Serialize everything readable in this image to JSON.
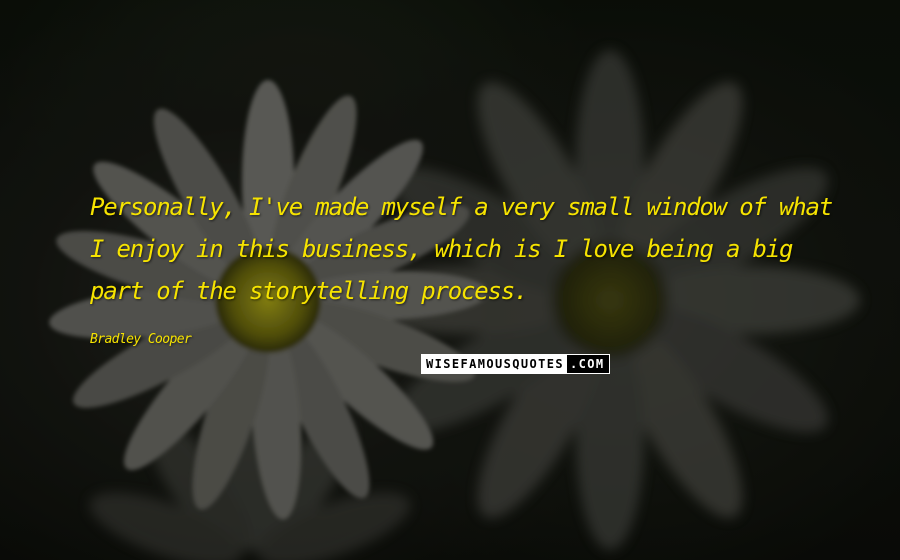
{
  "quote": {
    "text": "Personally, I've made myself a very small window of what I enjoy in this business, which is I love being a big part of the storytelling process."
  },
  "author": {
    "name": "Bradley Cooper"
  },
  "watermark": {
    "main": "WISEFAMOUSQUOTES",
    "tld": ".COM"
  },
  "colors": {
    "text": "#f6e300",
    "background": "#0c0f09",
    "petals": "#6f6f6a",
    "flower_center": "#8c8a12"
  },
  "background_image": {
    "subject": "dark blurred white daisy flowers"
  }
}
